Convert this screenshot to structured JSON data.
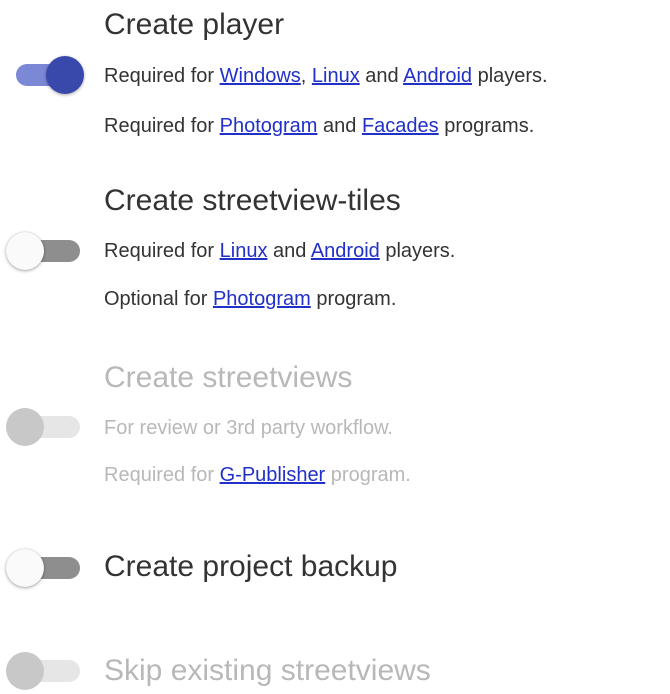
{
  "options": [
    {
      "title": "Create player",
      "state": "on",
      "lines": [
        {
          "parts": [
            "Required for ",
            {
              "link": "Windows"
            },
            ", ",
            {
              "link": "Linux"
            },
            " and ",
            {
              "link": "Android"
            },
            " players."
          ]
        },
        {
          "parts": [
            "Required for ",
            {
              "link": "Photogram"
            },
            " and ",
            {
              "link": "Facades"
            },
            " programs."
          ]
        }
      ]
    },
    {
      "title": "Create streetview-tiles",
      "state": "off",
      "lines": [
        {
          "parts": [
            "Required for ",
            {
              "link": "Linux"
            },
            " and ",
            {
              "link": "Android"
            },
            " players."
          ]
        },
        {
          "parts": [
            "Optional for ",
            {
              "link": "Photogram"
            },
            " program."
          ]
        }
      ]
    },
    {
      "title": "Create streetviews",
      "state": "disabled",
      "lines": [
        {
          "parts": [
            "For review or 3rd party workflow."
          ]
        },
        {
          "parts": [
            "Required for ",
            {
              "link": "G-Publisher"
            },
            " program."
          ]
        }
      ]
    },
    {
      "title": "Create project backup",
      "state": "off",
      "lines": []
    },
    {
      "title": "Skip existing streetviews",
      "state": "disabled",
      "lines": []
    }
  ],
  "colors": {
    "accent": "#3949ab",
    "accent_track": "#7b88d6",
    "link": "#2130c8",
    "disabled_text": "#b8b8b8"
  }
}
